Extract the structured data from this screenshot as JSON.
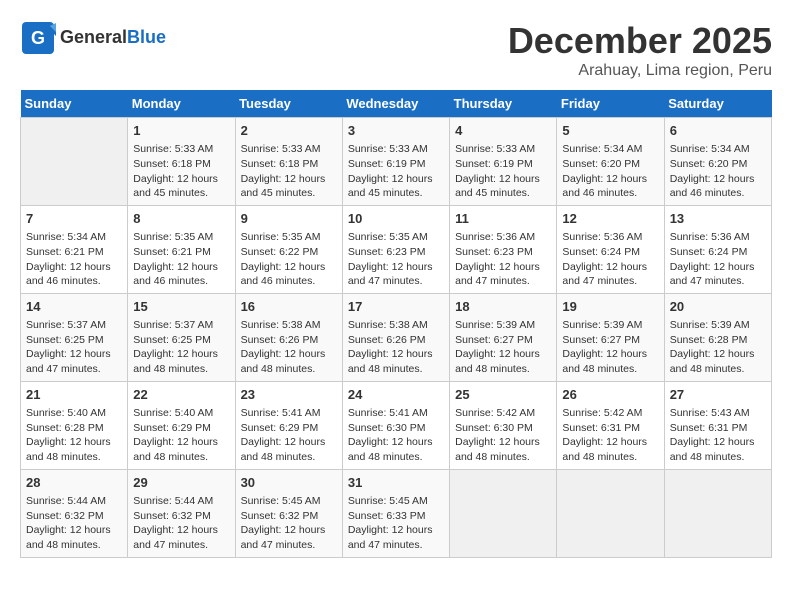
{
  "logo": {
    "line1": "General",
    "line2": "Blue"
  },
  "title": "December 2025",
  "location": "Arahuay, Lima region, Peru",
  "headers": [
    "Sunday",
    "Monday",
    "Tuesday",
    "Wednesday",
    "Thursday",
    "Friday",
    "Saturday"
  ],
  "weeks": [
    [
      {
        "day": "",
        "info": ""
      },
      {
        "day": "1",
        "info": "Sunrise: 5:33 AM\nSunset: 6:18 PM\nDaylight: 12 hours\nand 45 minutes."
      },
      {
        "day": "2",
        "info": "Sunrise: 5:33 AM\nSunset: 6:18 PM\nDaylight: 12 hours\nand 45 minutes."
      },
      {
        "day": "3",
        "info": "Sunrise: 5:33 AM\nSunset: 6:19 PM\nDaylight: 12 hours\nand 45 minutes."
      },
      {
        "day": "4",
        "info": "Sunrise: 5:33 AM\nSunset: 6:19 PM\nDaylight: 12 hours\nand 45 minutes."
      },
      {
        "day": "5",
        "info": "Sunrise: 5:34 AM\nSunset: 6:20 PM\nDaylight: 12 hours\nand 46 minutes."
      },
      {
        "day": "6",
        "info": "Sunrise: 5:34 AM\nSunset: 6:20 PM\nDaylight: 12 hours\nand 46 minutes."
      }
    ],
    [
      {
        "day": "7",
        "info": "Sunrise: 5:34 AM\nSunset: 6:21 PM\nDaylight: 12 hours\nand 46 minutes."
      },
      {
        "day": "8",
        "info": "Sunrise: 5:35 AM\nSunset: 6:21 PM\nDaylight: 12 hours\nand 46 minutes."
      },
      {
        "day": "9",
        "info": "Sunrise: 5:35 AM\nSunset: 6:22 PM\nDaylight: 12 hours\nand 46 minutes."
      },
      {
        "day": "10",
        "info": "Sunrise: 5:35 AM\nSunset: 6:23 PM\nDaylight: 12 hours\nand 47 minutes."
      },
      {
        "day": "11",
        "info": "Sunrise: 5:36 AM\nSunset: 6:23 PM\nDaylight: 12 hours\nand 47 minutes."
      },
      {
        "day": "12",
        "info": "Sunrise: 5:36 AM\nSunset: 6:24 PM\nDaylight: 12 hours\nand 47 minutes."
      },
      {
        "day": "13",
        "info": "Sunrise: 5:36 AM\nSunset: 6:24 PM\nDaylight: 12 hours\nand 47 minutes."
      }
    ],
    [
      {
        "day": "14",
        "info": "Sunrise: 5:37 AM\nSunset: 6:25 PM\nDaylight: 12 hours\nand 47 minutes."
      },
      {
        "day": "15",
        "info": "Sunrise: 5:37 AM\nSunset: 6:25 PM\nDaylight: 12 hours\nand 48 minutes."
      },
      {
        "day": "16",
        "info": "Sunrise: 5:38 AM\nSunset: 6:26 PM\nDaylight: 12 hours\nand 48 minutes."
      },
      {
        "day": "17",
        "info": "Sunrise: 5:38 AM\nSunset: 6:26 PM\nDaylight: 12 hours\nand 48 minutes."
      },
      {
        "day": "18",
        "info": "Sunrise: 5:39 AM\nSunset: 6:27 PM\nDaylight: 12 hours\nand 48 minutes."
      },
      {
        "day": "19",
        "info": "Sunrise: 5:39 AM\nSunset: 6:27 PM\nDaylight: 12 hours\nand 48 minutes."
      },
      {
        "day": "20",
        "info": "Sunrise: 5:39 AM\nSunset: 6:28 PM\nDaylight: 12 hours\nand 48 minutes."
      }
    ],
    [
      {
        "day": "21",
        "info": "Sunrise: 5:40 AM\nSunset: 6:28 PM\nDaylight: 12 hours\nand 48 minutes."
      },
      {
        "day": "22",
        "info": "Sunrise: 5:40 AM\nSunset: 6:29 PM\nDaylight: 12 hours\nand 48 minutes."
      },
      {
        "day": "23",
        "info": "Sunrise: 5:41 AM\nSunset: 6:29 PM\nDaylight: 12 hours\nand 48 minutes."
      },
      {
        "day": "24",
        "info": "Sunrise: 5:41 AM\nSunset: 6:30 PM\nDaylight: 12 hours\nand 48 minutes."
      },
      {
        "day": "25",
        "info": "Sunrise: 5:42 AM\nSunset: 6:30 PM\nDaylight: 12 hours\nand 48 minutes."
      },
      {
        "day": "26",
        "info": "Sunrise: 5:42 AM\nSunset: 6:31 PM\nDaylight: 12 hours\nand 48 minutes."
      },
      {
        "day": "27",
        "info": "Sunrise: 5:43 AM\nSunset: 6:31 PM\nDaylight: 12 hours\nand 48 minutes."
      }
    ],
    [
      {
        "day": "28",
        "info": "Sunrise: 5:44 AM\nSunset: 6:32 PM\nDaylight: 12 hours\nand 48 minutes."
      },
      {
        "day": "29",
        "info": "Sunrise: 5:44 AM\nSunset: 6:32 PM\nDaylight: 12 hours\nand 47 minutes."
      },
      {
        "day": "30",
        "info": "Sunrise: 5:45 AM\nSunset: 6:32 PM\nDaylight: 12 hours\nand 47 minutes."
      },
      {
        "day": "31",
        "info": "Sunrise: 5:45 AM\nSunset: 6:33 PM\nDaylight: 12 hours\nand 47 minutes."
      },
      {
        "day": "",
        "info": ""
      },
      {
        "day": "",
        "info": ""
      },
      {
        "day": "",
        "info": ""
      }
    ]
  ]
}
